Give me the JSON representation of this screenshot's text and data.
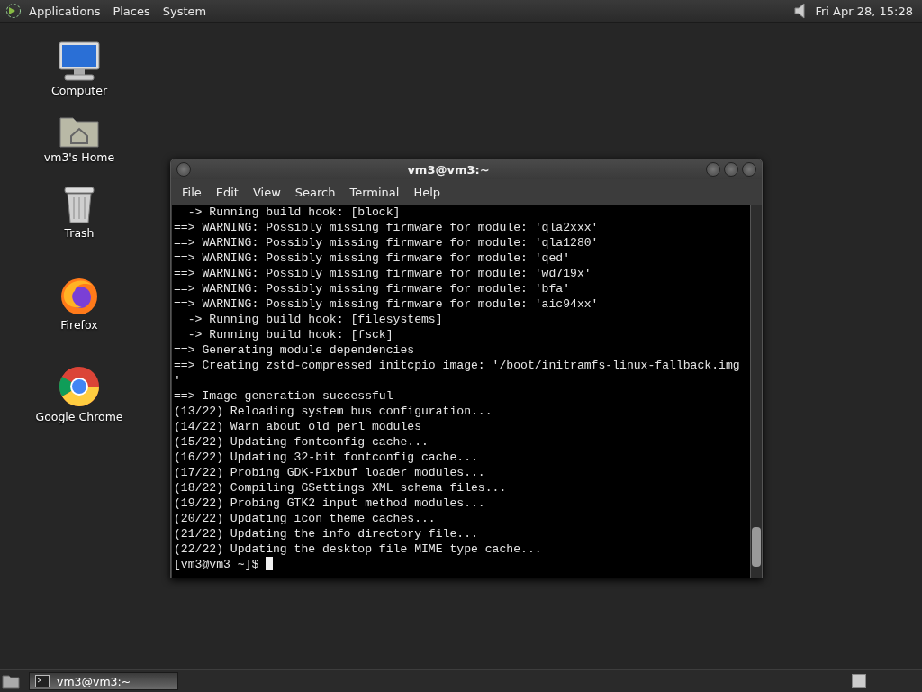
{
  "top_panel": {
    "menus": [
      "Applications",
      "Places",
      "System"
    ],
    "clock": "Fri Apr 28, 15:28"
  },
  "desktop_icons": [
    {
      "kind": "computer",
      "label": "Computer"
    },
    {
      "kind": "home",
      "label": "vm3's Home"
    },
    {
      "kind": "trash",
      "label": "Trash"
    },
    {
      "kind": "firefox",
      "label": "Firefox"
    },
    {
      "kind": "chrome",
      "label": "Google Chrome"
    }
  ],
  "window": {
    "title": "vm3@vm3:~",
    "menu": [
      "File",
      "Edit",
      "View",
      "Search",
      "Terminal",
      "Help"
    ],
    "terminal": {
      "lines": [
        "  -> Running build hook: [block]",
        "==> WARNING: Possibly missing firmware for module: 'qla2xxx'",
        "==> WARNING: Possibly missing firmware for module: 'qla1280'",
        "==> WARNING: Possibly missing firmware for module: 'qed'",
        "==> WARNING: Possibly missing firmware for module: 'wd719x'",
        "==> WARNING: Possibly missing firmware for module: 'bfa'",
        "==> WARNING: Possibly missing firmware for module: 'aic94xx'",
        "  -> Running build hook: [filesystems]",
        "  -> Running build hook: [fsck]",
        "==> Generating module dependencies",
        "==> Creating zstd-compressed initcpio image: '/boot/initramfs-linux-fallback.img",
        "'",
        "==> Image generation successful",
        "(13/22) Reloading system bus configuration...",
        "(14/22) Warn about old perl modules",
        "(15/22) Updating fontconfig cache...",
        "(16/22) Updating 32-bit fontconfig cache...",
        "(17/22) Probing GDK-Pixbuf loader modules...",
        "(18/22) Compiling GSettings XML schema files...",
        "(19/22) Probing GTK2 input method modules...",
        "(20/22) Updating icon theme caches...",
        "(21/22) Updating the info directory file...",
        "(22/22) Updating the desktop file MIME type cache..."
      ],
      "prompt": "[vm3@vm3 ~]$"
    }
  },
  "taskbar": {
    "tasks": [
      {
        "label": "vm3@vm3:~",
        "selected": true
      }
    ]
  }
}
